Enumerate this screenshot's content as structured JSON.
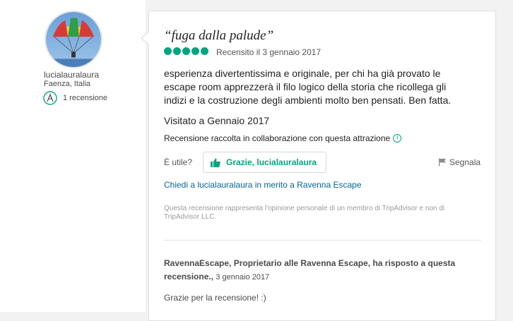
{
  "reviewer": {
    "username": "lucialauralaura",
    "location": "Faenza, Italia",
    "reviews_count": "1 recensione"
  },
  "review": {
    "title": "“fuga dalla palude”",
    "rating": 5,
    "rating_max": 5,
    "date_label": "Recensito il 3 gennaio 2017",
    "body": "esperienza divertentissima e originale, per chi ha già provato le escape room apprezzerà il filo logico della storia che ricollega gli indizi e la costruzione degli ambienti molto ben pensati. Ben fatta.",
    "visited": "Visitato a Gennaio 2017",
    "collab_note": "Recensione raccolta in collaborazione con questa attrazione",
    "useful_label": "È utile?",
    "thanks_button": "Grazie, lucialauralaura",
    "report_label": "Segnala",
    "ask_link": "Chiedi a lucialauralaura in merito a Ravenna Escape",
    "disclaimer": "Questa recensione rappresenta l'opinione personale di un membro di TripAdvisor e non di TripAdvisor LLC."
  },
  "owner_response": {
    "header": "RavennaEscape, Proprietario alle Ravenna Escape, ha risposto a questa recensione.,",
    "date": "3 gennaio 2017",
    "text": "Grazie per la recensione! :)"
  },
  "colors": {
    "accent": "#00a680",
    "link": "#006699"
  }
}
